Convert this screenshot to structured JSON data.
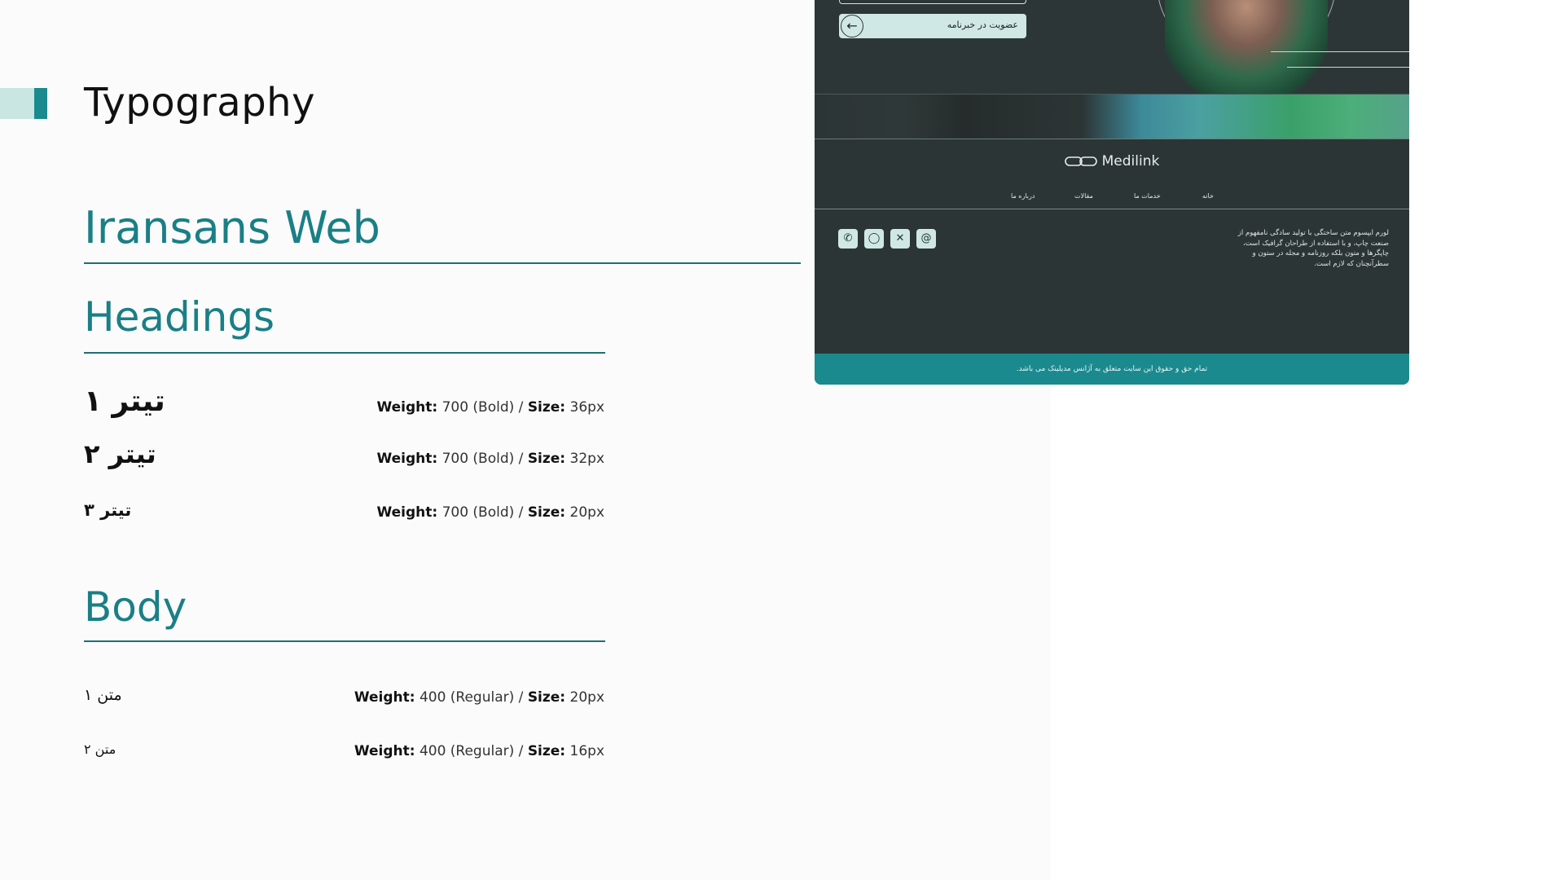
{
  "page": {
    "title": "Typography",
    "font_name": "Iransans Web",
    "accent_colors": {
      "primary": "#1a8a8f",
      "light": "#c9e6e2",
      "text": "#1a7f86"
    }
  },
  "headings": {
    "title": "Headings",
    "items": [
      {
        "name": "تیتر ۱",
        "weight_label": "Weight:",
        "weight": "700 (Bold)",
        "sep": "/",
        "size_label": "Size:",
        "size": "36px"
      },
      {
        "name": "تیتر ۲",
        "weight_label": "Weight:",
        "weight": "700 (Bold)",
        "sep": "/",
        "size_label": "Size:",
        "size": "32px"
      },
      {
        "name": "تیتر ۳",
        "weight_label": "Weight:",
        "weight": "700 (Bold)",
        "sep": "/",
        "size_label": "Size:",
        "size": "20px"
      }
    ]
  },
  "body": {
    "title": "Body",
    "items": [
      {
        "name": "متن ۱",
        "weight_label": "Weight:",
        "weight": "400 (Regular)",
        "sep": "/",
        "size_label": "Size:",
        "size": "20px"
      },
      {
        "name": "متن ۲",
        "weight_label": "Weight:",
        "weight": "400 (Regular)",
        "sep": "/",
        "size_label": "Size:",
        "size": "16px"
      }
    ]
  },
  "preview": {
    "newsletter_label": "عضویت در خبرنامه",
    "arrow_icon": "arrow-left-icon",
    "logo_text": "Medilink",
    "nav": [
      "خانه",
      "خدمات ما",
      "مقالات",
      "درباره ما"
    ],
    "social_icons": [
      "whatsapp-icon",
      "instagram-icon",
      "x-icon",
      "at-icon"
    ],
    "footer_text": "لورم ایپسوم متن ساختگی با تولید سادگی نامفهوم از صنعت چاپ، و با استفاده از طراحان گرافیک است، چاپگرها و متون بلکه روزنامه و مجله در ستون و سطرآنچنان که لازم است.",
    "copyright": "تمام حق و حقوق این سایت متعلق به آژانس مدیلینک می باشد."
  }
}
